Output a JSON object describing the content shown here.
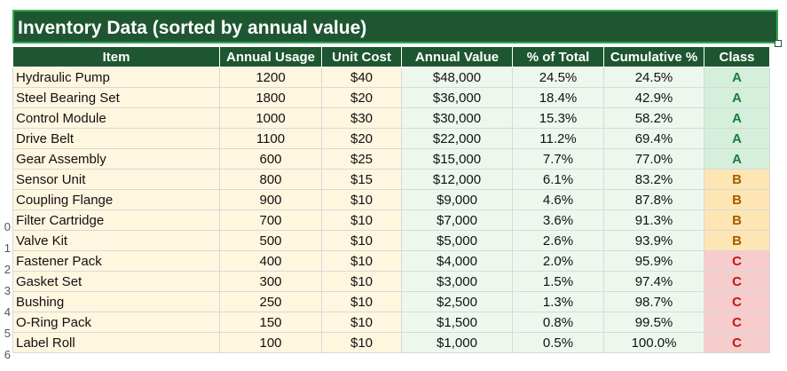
{
  "title": "Inventory Data (sorted by annual value)",
  "headers": [
    "Item",
    "Annual Usage",
    "Unit Cost",
    "Annual Value",
    "% of Total",
    "Cumulative %",
    "Class"
  ],
  "row_numbers": [
    "",
    "",
    "",
    "",
    "",
    "",
    "",
    "0",
    "1",
    "2",
    "3",
    "4",
    "5",
    "6"
  ],
  "rows": [
    {
      "item": "Hydraulic Pump",
      "usage": "1200",
      "cost": "$40",
      "value": "$48,000",
      "pct": "24.5%",
      "cum": "24.5%",
      "cls": "A"
    },
    {
      "item": "Steel Bearing Set",
      "usage": "1800",
      "cost": "$20",
      "value": "$36,000",
      "pct": "18.4%",
      "cum": "42.9%",
      "cls": "A"
    },
    {
      "item": "Control Module",
      "usage": "1000",
      "cost": "$30",
      "value": "$30,000",
      "pct": "15.3%",
      "cum": "58.2%",
      "cls": "A"
    },
    {
      "item": "Drive Belt",
      "usage": "1100",
      "cost": "$20",
      "value": "$22,000",
      "pct": "11.2%",
      "cum": "69.4%",
      "cls": "A"
    },
    {
      "item": "Gear Assembly",
      "usage": "600",
      "cost": "$25",
      "value": "$15,000",
      "pct": "7.7%",
      "cum": "77.0%",
      "cls": "A"
    },
    {
      "item": "Sensor Unit",
      "usage": "800",
      "cost": "$15",
      "value": "$12,000",
      "pct": "6.1%",
      "cum": "83.2%",
      "cls": "B"
    },
    {
      "item": "Coupling Flange",
      "usage": "900",
      "cost": "$10",
      "value": "$9,000",
      "pct": "4.6%",
      "cum": "87.8%",
      "cls": "B"
    },
    {
      "item": "Filter Cartridge",
      "usage": "700",
      "cost": "$10",
      "value": "$7,000",
      "pct": "3.6%",
      "cum": "91.3%",
      "cls": "B"
    },
    {
      "item": "Valve Kit",
      "usage": "500",
      "cost": "$10",
      "value": "$5,000",
      "pct": "2.6%",
      "cum": "93.9%",
      "cls": "B"
    },
    {
      "item": "Fastener Pack",
      "usage": "400",
      "cost": "$10",
      "value": "$4,000",
      "pct": "2.0%",
      "cum": "95.9%",
      "cls": "C"
    },
    {
      "item": "Gasket Set",
      "usage": "300",
      "cost": "$10",
      "value": "$3,000",
      "pct": "1.5%",
      "cum": "97.4%",
      "cls": "C"
    },
    {
      "item": "Bushing",
      "usage": "250",
      "cost": "$10",
      "value": "$2,500",
      "pct": "1.3%",
      "cum": "98.7%",
      "cls": "C"
    },
    {
      "item": "O-Ring Pack",
      "usage": "150",
      "cost": "$10",
      "value": "$1,500",
      "pct": "0.8%",
      "cum": "99.5%",
      "cls": "C"
    },
    {
      "item": "Label Roll",
      "usage": "100",
      "cost": "$10",
      "value": "$1,000",
      "pct": "0.5%",
      "cum": "100.0%",
      "cls": "C"
    }
  ],
  "colors": {
    "header_green": "#1e5631",
    "class_a": "#d4efdc",
    "class_b": "#fde6b3",
    "class_c": "#f6cccc"
  }
}
